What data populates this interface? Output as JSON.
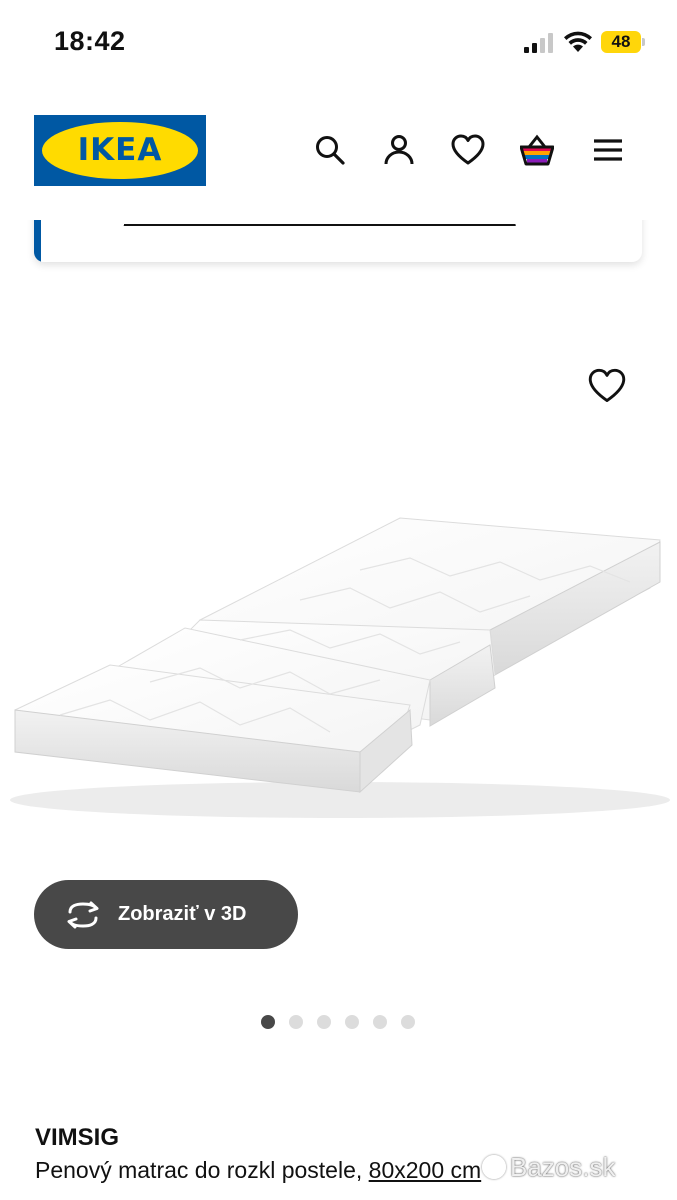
{
  "status_bar": {
    "time": "18:42",
    "battery": "48",
    "battery_color": "#ffd60a"
  },
  "header": {
    "logo_text": "IKEA",
    "brand_blue": "#0058a3",
    "brand_yellow": "#ffdb00",
    "icons": [
      "search-icon",
      "account-icon",
      "heart-icon",
      "basket-icon",
      "menu-icon"
    ]
  },
  "notice": {
    "text": "____________________________________________"
  },
  "product": {
    "view_3d_label": "Zobraziť v 3D",
    "carousel_count": 6,
    "carousel_active": 1,
    "name": "VIMSIG",
    "description": "Penový matrac do rozkl postele,",
    "size": "80x200 cm"
  },
  "watermark": {
    "text": "Bazos.sk"
  }
}
